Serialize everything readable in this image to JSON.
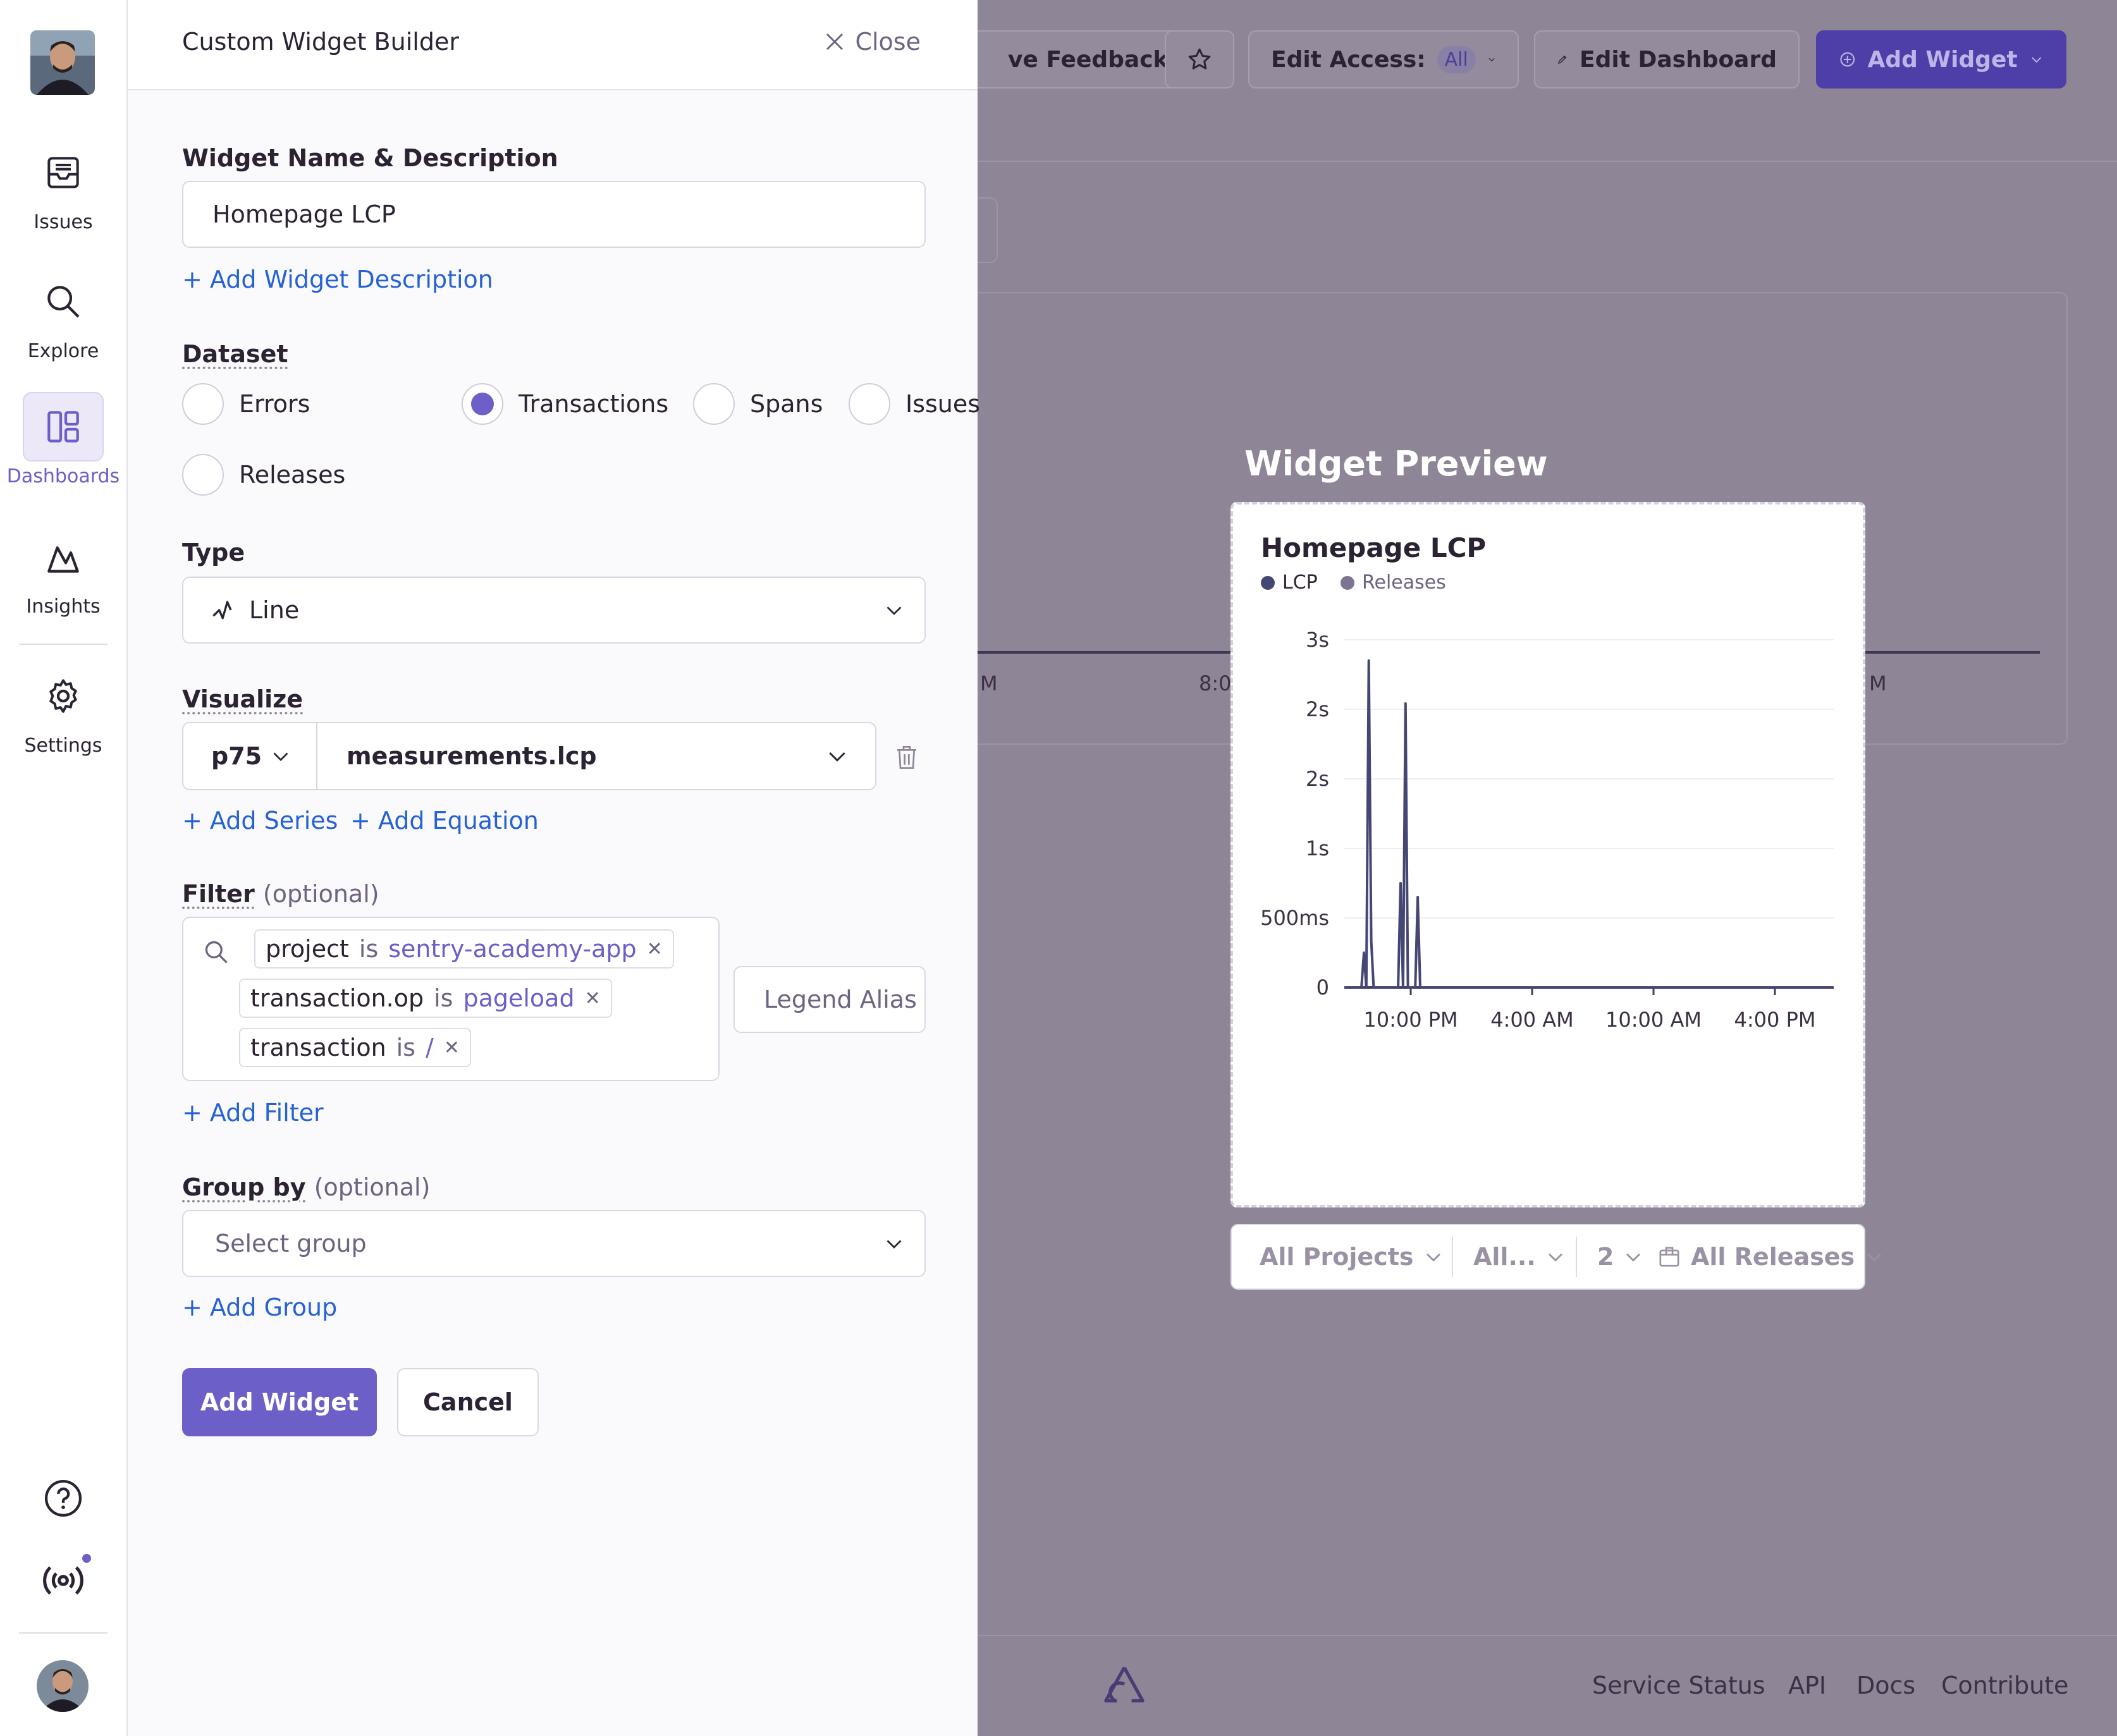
{
  "rail": {
    "items": [
      {
        "label": "Issues",
        "icon": "inbox-icon"
      },
      {
        "label": "Explore",
        "icon": "search-icon"
      },
      {
        "label": "Dashboards",
        "icon": "dashboard-icon"
      },
      {
        "label": "Insights",
        "icon": "insights-icon"
      },
      {
        "label": "Settings",
        "icon": "gear-icon"
      }
    ],
    "active": "Dashboards"
  },
  "header_bg": {
    "feedback_label": "ve Feedback",
    "edit_access_label": "Edit Access:",
    "edit_access_value": "All",
    "edit_dashboard_label": "Edit Dashboard",
    "add_widget_label": "Add Widget"
  },
  "bg_chart_ticks": [
    "M",
    "8:0",
    "M"
  ],
  "panel": {
    "title": "Custom Widget Builder",
    "close_label": "Close",
    "name_section_label": "Widget Name & Description",
    "widget_name_value": "Homepage LCP",
    "add_description_label": "+ Add Widget Description",
    "dataset_label": "Dataset",
    "datasets": [
      "Errors",
      "Transactions",
      "Spans",
      "Issues",
      "Releases"
    ],
    "selected_dataset": "Transactions",
    "type_label": "Type",
    "type_value": "Line",
    "visualize_label": "Visualize",
    "aggregate_value": "p75",
    "field_value": "measurements.lcp",
    "add_series_label": "+ Add Series",
    "add_equation_label": "+ Add Equation",
    "filter_label": "Filter",
    "optional_label": "(optional)",
    "filters": [
      {
        "key": "project",
        "op": "is",
        "value": "sentry-academy-app"
      },
      {
        "key": "transaction.op",
        "op": "is",
        "value": "pageload"
      },
      {
        "key": "transaction",
        "op": "is",
        "value": "/"
      }
    ],
    "legend_alias_placeholder": "Legend Alias",
    "add_filter_label": "+ Add Filter",
    "group_by_label": "Group by",
    "group_placeholder": "Select group",
    "add_group_label": "+ Add Group",
    "submit_label": "Add Widget",
    "cancel_label": "Cancel"
  },
  "preview": {
    "heading": "Widget Preview",
    "card_title": "Homepage LCP",
    "legend": [
      {
        "name": "LCP",
        "color": "#444674"
      },
      {
        "name": "Releases",
        "color": "#7f7394"
      }
    ]
  },
  "chart_data": {
    "type": "line",
    "title": "Homepage LCP",
    "series": [
      {
        "name": "LCP",
        "points": [
          [
            0.0,
            0
          ],
          [
            0.035,
            0
          ],
          [
            0.04,
            300
          ],
          [
            0.045,
            0
          ],
          [
            0.05,
            2820
          ],
          [
            0.055,
            400
          ],
          [
            0.06,
            0
          ],
          [
            0.11,
            0
          ],
          [
            0.115,
            900
          ],
          [
            0.12,
            0
          ],
          [
            0.125,
            2450
          ],
          [
            0.13,
            0
          ],
          [
            0.145,
            0
          ],
          [
            0.15,
            780
          ],
          [
            0.155,
            0
          ],
          [
            0.2,
            0
          ],
          [
            0.5,
            0
          ],
          [
            0.75,
            0
          ],
          [
            1.0,
            0
          ]
        ]
      }
    ],
    "x_ticks": [
      "10:00 PM",
      "4:00 AM",
      "10:00 AM",
      "4:00 PM"
    ],
    "y_ticks": [
      "0",
      "500ms",
      "1s",
      "2s",
      "2s",
      "3s"
    ],
    "ylim": [
      0,
      3000
    ],
    "grid": true,
    "legend_position": "top-left"
  },
  "filter_bar": {
    "projects_label": "All Projects",
    "environments_label": "All...",
    "period_label": "2",
    "releases_label": "All Releases"
  },
  "footer": {
    "links": [
      "Service Status",
      "API",
      "Docs",
      "Contribute"
    ]
  },
  "colors": {
    "accent": "#6c5fc7",
    "link": "#2562d4",
    "chart_line": "#444674",
    "overlay": "#8e8596"
  }
}
